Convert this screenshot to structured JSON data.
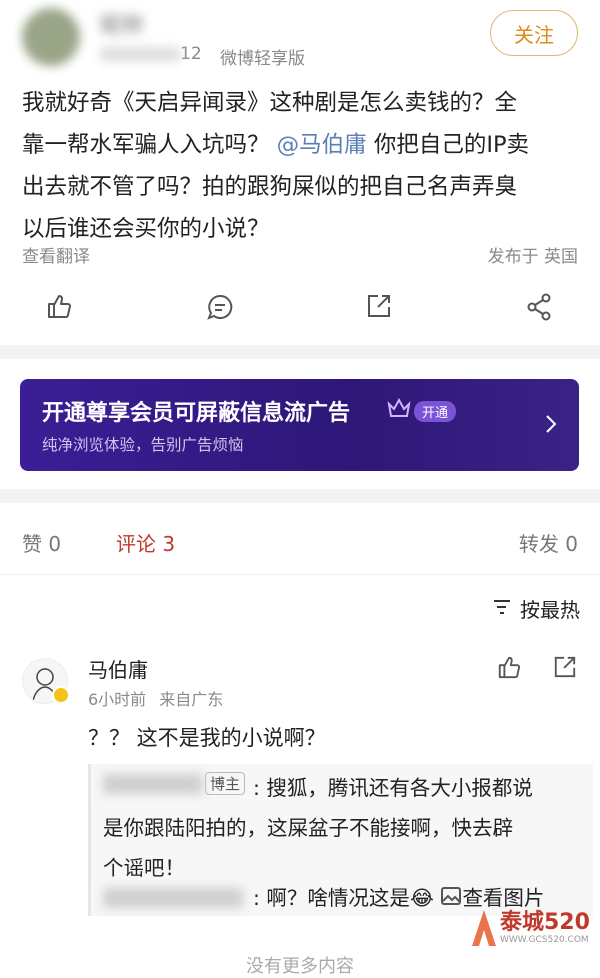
{
  "post": {
    "author_name": "昵称",
    "date": "12",
    "source": "微博轻享版",
    "follow_label": "关注",
    "body_line1": "我就好奇《天启异闻录》这种剧是怎么卖钱的？全",
    "body_line2_a": "靠一帮水军骗人入坑吗？",
    "mention": "@马伯庸",
    "body_line2_b": "你把自己的IP卖",
    "body_line3": "出去就不管了吗？拍的跟狗屎似的把自己名声弄臭",
    "body_line4": "以后谁还会买你的小说？",
    "translate_label": "查看翻译",
    "published_location": "发布于 英国"
  },
  "ad": {
    "title": "开通尊享会员可屏蔽信息流广告",
    "badge": "开通",
    "subtitle": "纯净浏览体验，告别广告烦恼",
    "colors": {
      "bg_from": "#3a1d93",
      "bg_to": "#2b1672"
    }
  },
  "stats_bar": {
    "likes": "赞 0",
    "comments": "评论 3",
    "reposts": "转发 0"
  },
  "sort": {
    "label": "按最热"
  },
  "comment": {
    "author": "马伯庸",
    "time": "6小时前",
    "location": "来自广东",
    "text": "？？ 这不是我的小说啊？",
    "reply1_name": "",
    "reply1_tag": "博主",
    "reply1_line1": ": 搜狐，腾讯还有各大小报都说",
    "reply1_line2": "是你跟陆阳拍的，这屎盆子不能接啊，快去辟",
    "reply1_line3": "个谣吧！",
    "reply2_text": ": 啊？啥情况这是",
    "reply2_emoji": "😂",
    "view_image": "查看图片"
  },
  "footer": {
    "more": "没有更多内容"
  },
  "watermark": {
    "text": "泰城520",
    "sub": "WWW.GCS520.COM"
  },
  "colors": {
    "accent": "#ff8200",
    "mention": "#5b7fb2",
    "active_tab": "#c0392b"
  }
}
